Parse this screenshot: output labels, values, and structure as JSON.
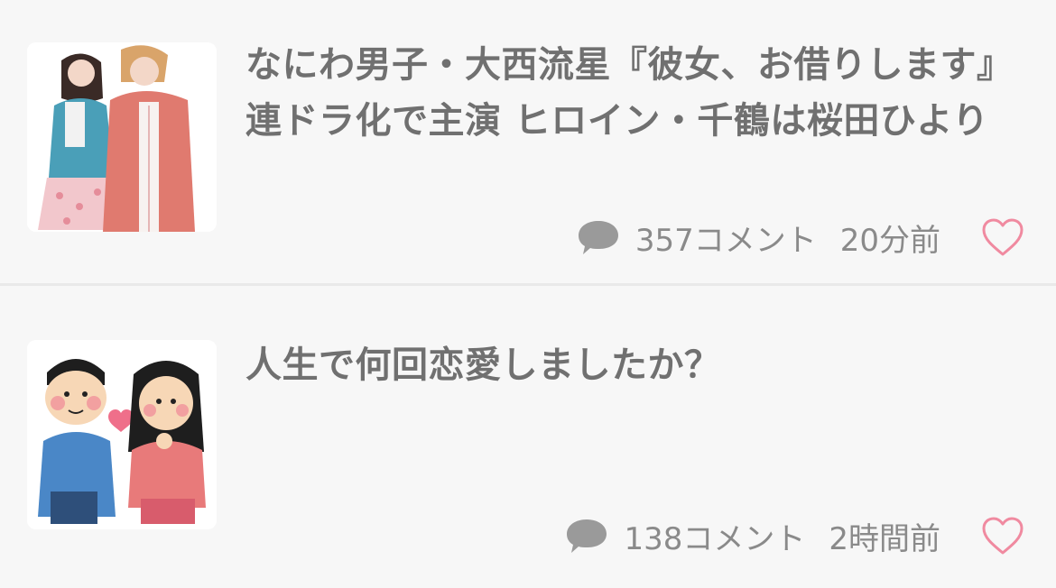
{
  "articles": [
    {
      "title": "なにわ男子・大西流星『彼女、お借りします』連ドラ化で主演 ヒロイン・千鶴は桜田ひより",
      "comments": "357コメント",
      "time": "20分前"
    },
    {
      "title": "人生で何回恋愛しましたか？",
      "comments": "138コメント",
      "time": "2時間前"
    }
  ],
  "colors": {
    "background": "#f7f7f7",
    "title_text": "#707070",
    "meta_text": "#8a8a8a",
    "comment_icon": "#9a9a9a",
    "heart_outline": "#f08aa0",
    "divider": "#e9e9e9"
  },
  "icons": {
    "comment": "comment-bubble-icon",
    "like": "heart-outline-icon"
  }
}
